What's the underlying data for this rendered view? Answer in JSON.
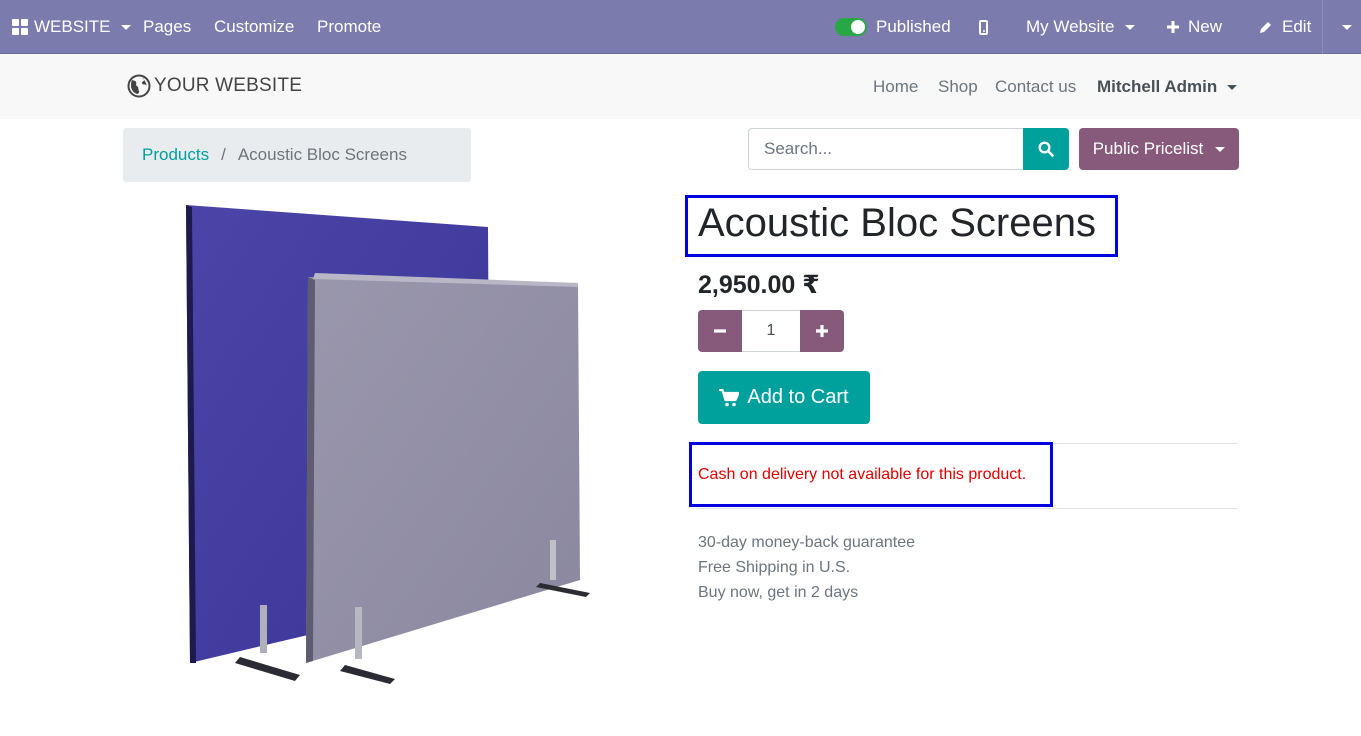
{
  "adminbar": {
    "app_menu": "WEBSITE",
    "pages": "Pages",
    "customize": "Customize",
    "promote": "Promote",
    "published": "Published",
    "my_website": "My Website",
    "new": "New",
    "edit": "Edit"
  },
  "header": {
    "logo_text": "YOUR WEBSITE",
    "nav": [
      "Home",
      "Shop",
      "Contact us"
    ],
    "user": "Mitchell Admin"
  },
  "breadcrumb": {
    "parent": "Products",
    "separator": "/",
    "current": "Acoustic Bloc Screens"
  },
  "search": {
    "placeholder": "Search..."
  },
  "pricelist": "Public Pricelist",
  "product": {
    "name": "Acoustic Bloc Screens",
    "price": "2,950.00 ₹",
    "quantity": "1",
    "add_to_cart": "Add to Cart",
    "cod_notice": "Cash on delivery not available for this product.",
    "guarantees": [
      "30-day money-back guarantee",
      "Free Shipping in U.S.",
      "Buy now, get in 2 days"
    ]
  },
  "colors": {
    "adminbar": "#7c7bad",
    "primary": "#875a7b",
    "accent": "#00a09d",
    "highlight_border": "#0000e0",
    "notice_red": "#e00000"
  }
}
